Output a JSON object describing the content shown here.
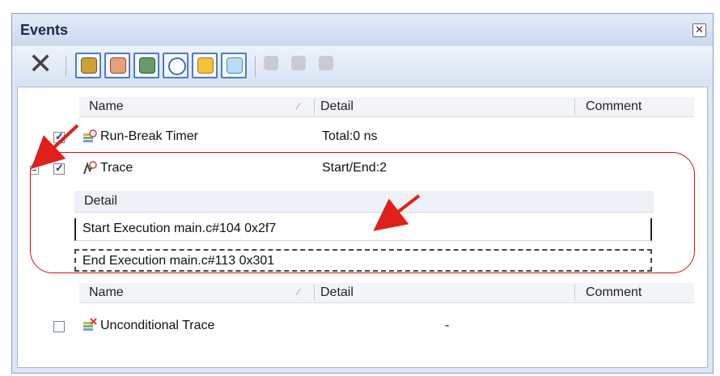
{
  "window": {
    "title": "Events"
  },
  "toolbar": {
    "buttons": [
      {
        "name": "hardware-break-icon",
        "color": "#8a6a1c"
      },
      {
        "name": "software-break-icon",
        "color": "#b85a2e"
      },
      {
        "name": "trace-icon",
        "color": "#2d5a2d"
      },
      {
        "name": "timer-icon",
        "color": "#3b6fb5"
      },
      {
        "name": "performance-icon",
        "color": "#d89b1a"
      },
      {
        "name": "print-icon",
        "color": "#3a8ecf"
      }
    ],
    "disabled_buttons": [
      "edit-condition-icon",
      "copy-icon",
      "paste-icon"
    ]
  },
  "table1": {
    "columns": [
      "Name",
      "Detail",
      "Comment"
    ],
    "rows": [
      {
        "name": "Run-Break Timer",
        "detail": "Total:0 ns",
        "comment": "",
        "checked": true
      },
      {
        "name": "Trace",
        "detail": "Start/End:2",
        "comment": "",
        "checked": true
      }
    ],
    "sub_header": "Detail",
    "sub_rows": [
      "Start Execution main.c#104 0x2f7",
      "End Execution main.c#113 0x301"
    ]
  },
  "table2": {
    "columns": [
      "Name",
      "Detail",
      "Comment"
    ],
    "rows": [
      {
        "name": "Unconditional Trace",
        "detail": "-",
        "comment": "",
        "checked": false
      }
    ]
  },
  "colors": {
    "highlight": "#d31010",
    "arrow": "#e0201a",
    "toolbar_border": "#4d7cc9"
  }
}
